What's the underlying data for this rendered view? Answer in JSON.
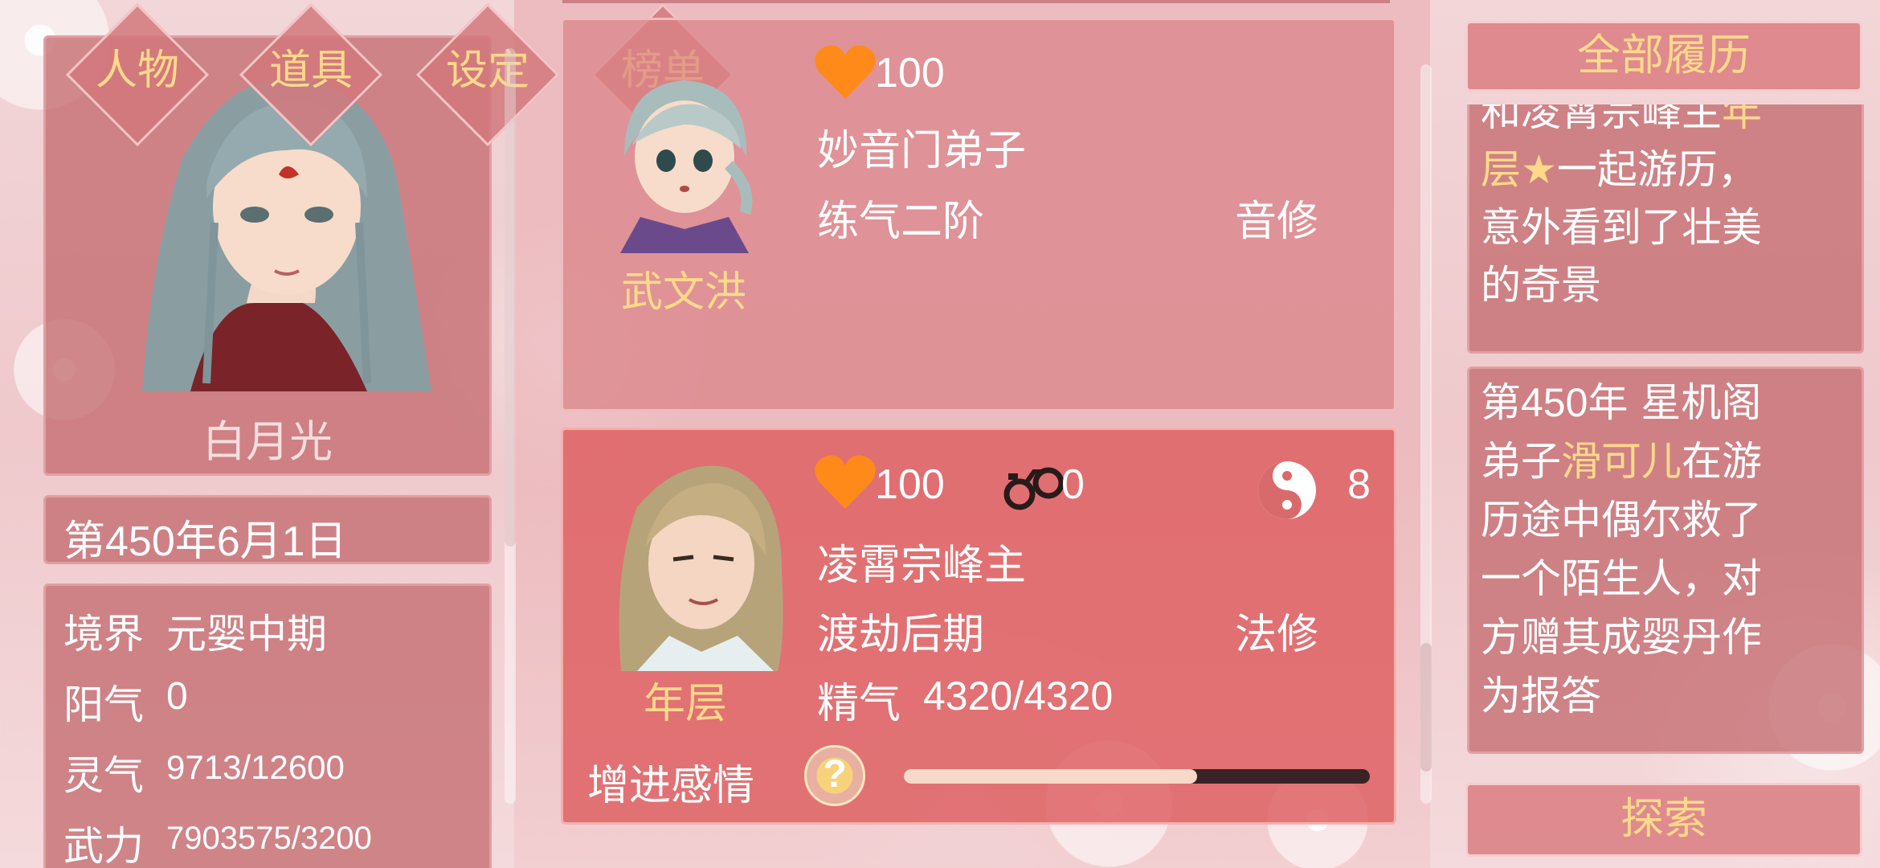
{
  "nav": {
    "character": "人物",
    "items": "道具",
    "settings": "设定",
    "ranking": "榜单"
  },
  "player": {
    "name": "白月光",
    "date": "第450年6月1日",
    "stats": [
      {
        "label": "境界",
        "value": "元婴中期"
      },
      {
        "label": "阳气",
        "value": "0"
      },
      {
        "label": "灵气",
        "value": "9713/12600"
      },
      {
        "label": "武力",
        "value": "7903575/3200"
      }
    ]
  },
  "cards": [
    {
      "name": "武文洪",
      "affection": "100",
      "sect": "妙音门弟子",
      "realm": "练气二阶",
      "school": "音修"
    },
    {
      "name": "年层",
      "affection": "100",
      "bond": "0",
      "yinyang": "8",
      "sect": "凌霄宗峰主",
      "realm": "渡劫后期",
      "school": "法修",
      "essence_label": "精气",
      "essence": "4320/4320",
      "action_label": "增进感情",
      "help": "?",
      "progress": 0.63
    }
  ],
  "history": {
    "header": "全部履历",
    "entry1": {
      "line0_a": "和凌霄宗峰主",
      "line0_b": "年",
      "line1_a": "层",
      "star": "★",
      "line1_b": "一起游历，",
      "line2": "意外看到了壮美",
      "line3": "的奇景"
    },
    "entry2": {
      "l1_a": "第",
      "l1_num": "450",
      "l1_b": "年 星机阁",
      "l2_a": "弟子",
      "l2_name": "滑可儿",
      "l2_b": "在游",
      "l3": "历途中偶尔救了",
      "l4": "一个陌生人，对",
      "l5": "方赠其成婴丹作",
      "l6": "为报答"
    },
    "explore": "探索"
  },
  "colors": {
    "gold": "#ffd98a",
    "heart": "#ff8a1a",
    "panel": "#c46c70",
    "card_active": "#d96a6c"
  },
  "icons": {
    "heart": "heart-icon",
    "bond": "handcuffs-icon",
    "yinyang": "yinyang-icon",
    "help": "question-icon"
  }
}
